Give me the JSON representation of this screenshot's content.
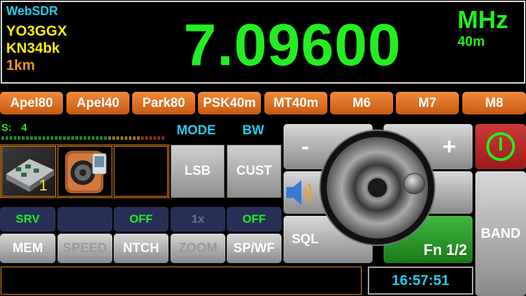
{
  "header": {
    "app_name": "WebSDR",
    "callsign": "YO3GGX",
    "locator": "KN34bk",
    "distance": "1km",
    "frequency": "7.09600",
    "unit": "MHz",
    "band": "40m"
  },
  "memories": [
    "Apel80",
    "Apel40",
    "Park80",
    "PSK40m",
    "MT40m",
    "M6",
    "M7",
    "M8"
  ],
  "signal": {
    "label": "S:",
    "value": "4"
  },
  "labels": {
    "mode": "MODE",
    "bw": "BW"
  },
  "servers": {
    "active_index": "1"
  },
  "mode": {
    "value": "LSB",
    "bw": "CUST"
  },
  "status_row": [
    "SRV",
    "",
    "OFF",
    "1x",
    "OFF"
  ],
  "func_row": [
    "MEM",
    "SPEED",
    "NTCH",
    "ZOOM",
    "SP/WF"
  ],
  "controls": {
    "minus": "-",
    "plus": "+",
    "sql": "SQL",
    "fn": "Fn 1/2",
    "band": "BAND"
  },
  "clock": "16:57:51",
  "colors": {
    "freq_green": "#22ee22",
    "orange": "#e87020",
    "yellow": "#ffee00",
    "cyan": "#22ccee"
  }
}
